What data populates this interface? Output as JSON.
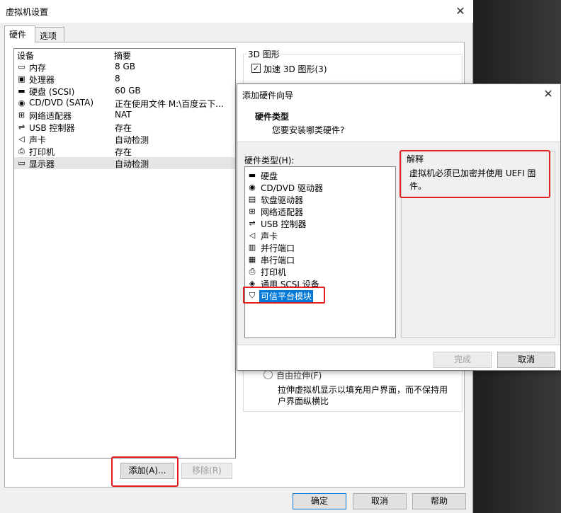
{
  "window": {
    "title": "虚拟机设置",
    "close": "✕",
    "tabs": [
      "硬件",
      "选项"
    ]
  },
  "device_list": {
    "columns": [
      "设备",
      "摘要"
    ],
    "rows": [
      {
        "icon": "memory-icon",
        "glyph": "▭",
        "name": "内存",
        "summary": "8 GB"
      },
      {
        "icon": "cpu-icon",
        "glyph": "▣",
        "name": "处理器",
        "summary": "8"
      },
      {
        "icon": "hard-disk-icon",
        "glyph": "▬",
        "name": "硬盘 (SCSI)",
        "summary": "60 GB"
      },
      {
        "icon": "cd-dvd-icon",
        "glyph": "◉",
        "name": "CD/DVD (SATA)",
        "summary": "正在使用文件 M:\\百度云下..."
      },
      {
        "icon": "network-adapter-icon",
        "glyph": "⊞",
        "name": "网络适配器",
        "summary": "NAT"
      },
      {
        "icon": "usb-icon",
        "glyph": "⇌",
        "name": "USB 控制器",
        "summary": "存在"
      },
      {
        "icon": "sound-card-icon",
        "glyph": "◁",
        "name": "声卡",
        "summary": "自动检测"
      },
      {
        "icon": "printer-icon",
        "glyph": "⎙",
        "name": "打印机",
        "summary": "存在"
      },
      {
        "icon": "display-icon",
        "glyph": "▭",
        "name": "显示器",
        "summary": "自动检测"
      }
    ]
  },
  "display_settings": {
    "group_3d_title": "3D 图形",
    "accelerate_3d_label": "加速 3D 图形(3)",
    "accelerate_3d_checked": "✓",
    "stretch_label": "自由拉伸(F)",
    "stretch_description": "拉伸虚拟机显示以填充用户界面，而不保持用户界面纵横比"
  },
  "buttons": {
    "add": "添加(A)...",
    "remove": "移除(R)",
    "ok": "确定",
    "cancel": "取消",
    "help": "帮助"
  },
  "wizard": {
    "title": "添加硬件向导",
    "close": "✕",
    "heading": "硬件类型",
    "subheading": "您要安装哪类硬件?",
    "hw_type_label": "硬件类型(H):",
    "hardware_types": [
      {
        "icon": "hard-disk-icon",
        "glyph": "▬",
        "label": "硬盘"
      },
      {
        "icon": "cd-dvd-icon",
        "glyph": "◉",
        "label": "CD/DVD 驱动器"
      },
      {
        "icon": "floppy-icon",
        "glyph": "▤",
        "label": "软盘驱动器"
      },
      {
        "icon": "network-adapter-icon",
        "glyph": "⊞",
        "label": "网络适配器"
      },
      {
        "icon": "usb-icon",
        "glyph": "⇌",
        "label": "USB 控制器"
      },
      {
        "icon": "sound-card-icon",
        "glyph": "◁",
        "label": "声卡"
      },
      {
        "icon": "parallel-port-icon",
        "glyph": "▥",
        "label": "并行端口"
      },
      {
        "icon": "serial-port-icon",
        "glyph": "▦",
        "label": "串行端口"
      },
      {
        "icon": "printer-icon",
        "glyph": "⎙",
        "label": "打印机"
      },
      {
        "icon": "scsi-device-icon",
        "glyph": "◈",
        "label": "通用 SCSI 设备"
      },
      {
        "icon": "tpm-icon",
        "glyph": "⛉",
        "label": "可信平台模块"
      }
    ],
    "explain_title": "解释",
    "explain_text": "虚拟机必须已加密并使用 UEFI 固件。",
    "finish": "完成",
    "cancel": "取消"
  },
  "colors": {
    "highlight_red": "#e02020",
    "selection_blue": "#0078d7"
  }
}
